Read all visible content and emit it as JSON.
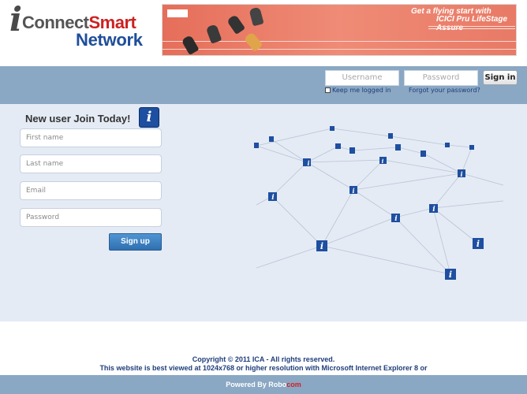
{
  "logo": {
    "mark": "i",
    "connect": "Connect",
    "smart": "Smart",
    "network": "Network"
  },
  "banner": {
    "line1": "Get a flying start with",
    "line2": "ICICI Pru LifeStage Assure"
  },
  "login": {
    "username_placeholder": "Username",
    "password_placeholder": "Password",
    "signin_label": "Sign in",
    "keep_logged_in": "Keep me logged in",
    "forgot_password": "Forgot your password?"
  },
  "signup": {
    "title": "New user Join Today!",
    "icon_glyph": "i",
    "first_name_placeholder": "First name",
    "last_name_placeholder": "Last name",
    "email_placeholder": "Email",
    "password_placeholder": "Password",
    "button_label": "Sign up"
  },
  "footer": {
    "copyright": "Copyright © 2011 ICA - All rights reserved.",
    "resolution_note": "This website is best viewed at 1024x768 or higher resolution with Microsoft Internet Explorer 8 or",
    "powered_by": "Powered By",
    "brand_robo": "Robo",
    "brand_com": "com"
  },
  "colors": {
    "topbar": "#8aa7c3",
    "panel": "#e5ebf5",
    "icon_blue": "#1e4fa0",
    "signup_button": "#3f82c4",
    "link_blue": "#1f3d7a",
    "brand_red": "#d42020"
  }
}
